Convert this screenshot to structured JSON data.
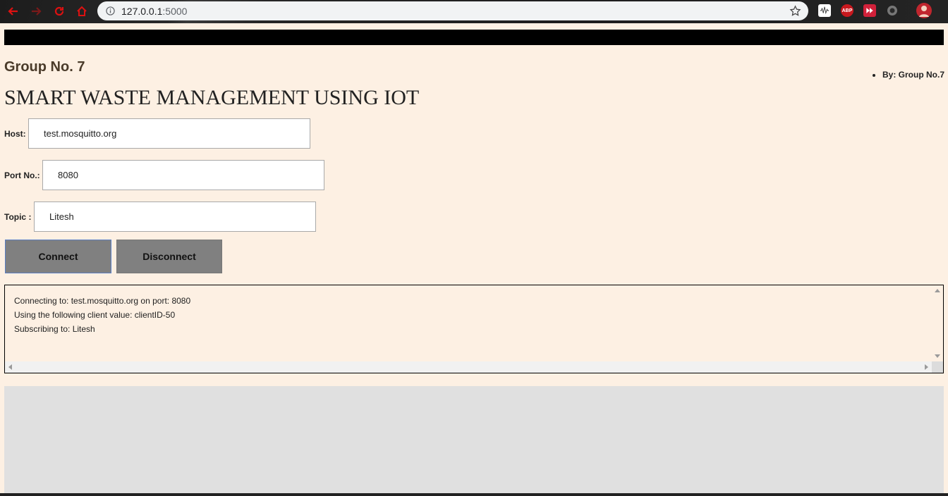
{
  "browser": {
    "url_host": "127.0.0.1",
    "url_port": ":5000",
    "extensions": [
      "ABP"
    ]
  },
  "page": {
    "group_title": "Group No. 7",
    "author_item": "By: Group No.7",
    "main_title": "SMART WASTE MANAGEMENT USING IOT"
  },
  "form": {
    "host_label": "Host:",
    "host_value": "test.mosquitto.org",
    "port_label": "Port No.:",
    "port_value": "8080",
    "topic_label": "Topic :",
    "topic_value": "Litesh"
  },
  "buttons": {
    "connect": "Connect",
    "disconnect": "Disconnect"
  },
  "log": [
    "Connecting to: test.mosquitto.org on port: 8080",
    "Using the following client value: clientID-50",
    "Subscribing to: Litesh"
  ],
  "colors": {
    "page_bg": "#fdf0e3",
    "button_bg": "#808080",
    "panel_bg": "#e0e0e0"
  }
}
